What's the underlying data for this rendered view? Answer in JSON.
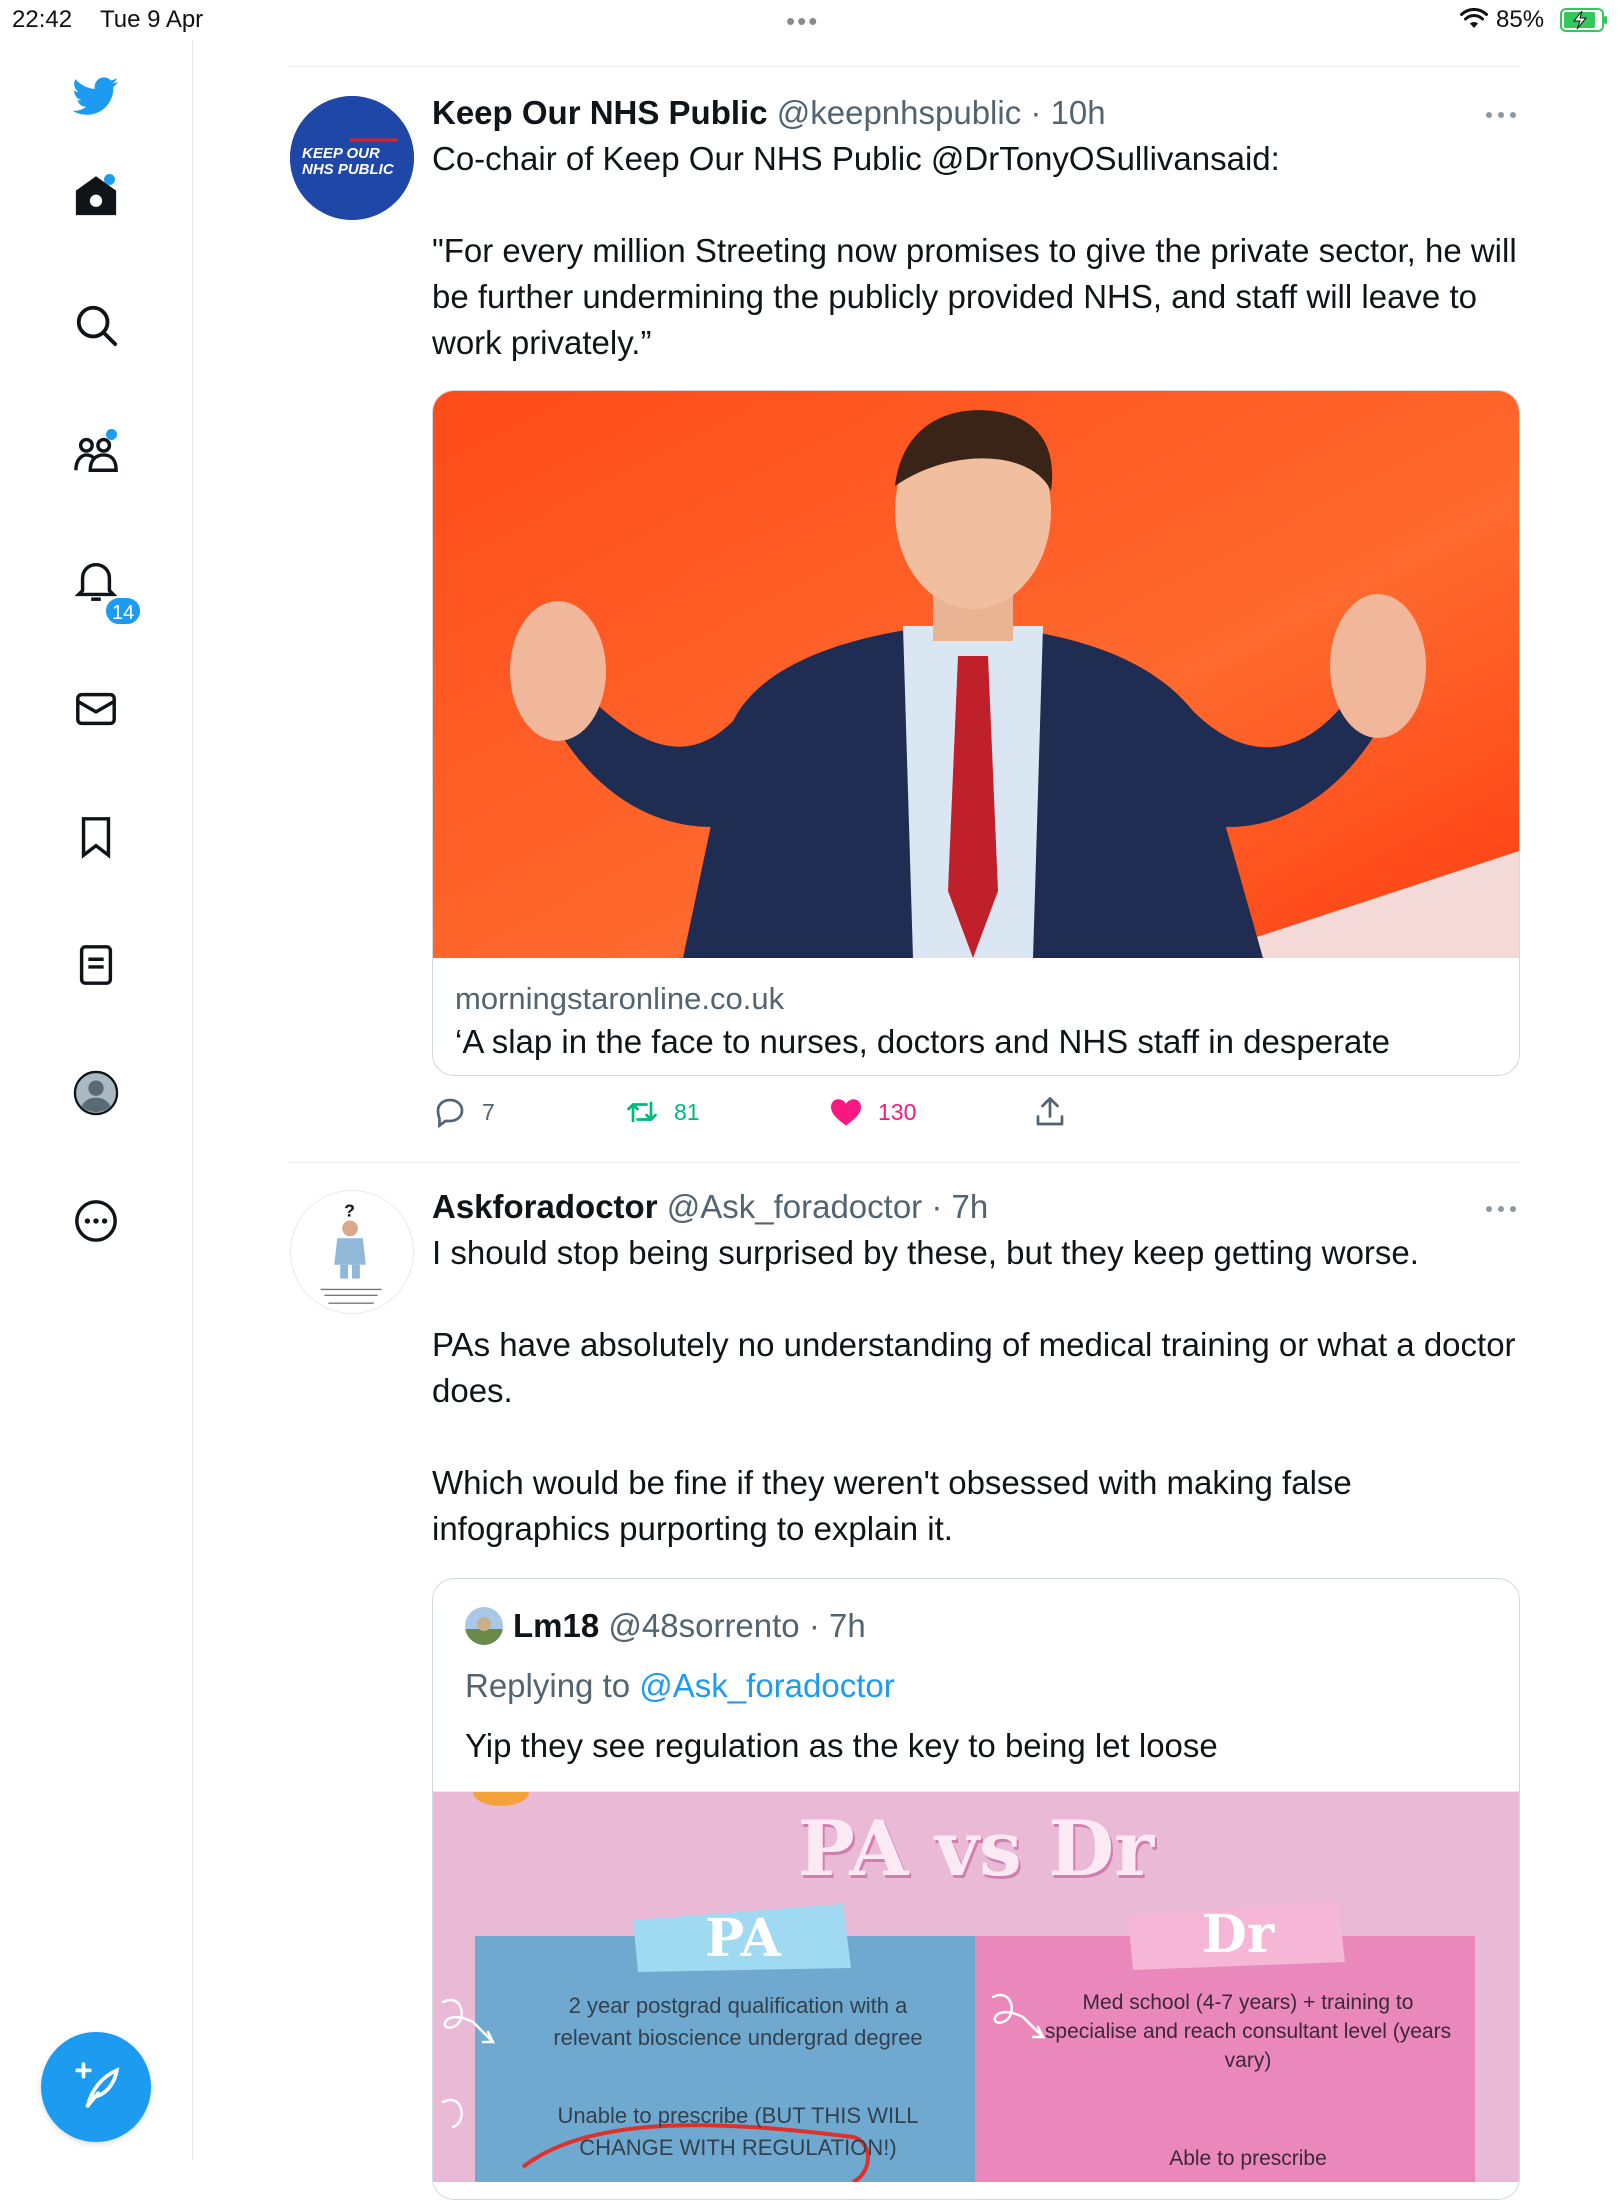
{
  "status_bar": {
    "time": "22:42",
    "date": "Tue 9 Apr",
    "battery": "85%"
  },
  "sidebar": {
    "items": [
      {
        "name": "twitter-logo",
        "icon": "bird-icon"
      },
      {
        "name": "home",
        "icon": "home-icon"
      },
      {
        "name": "explore",
        "icon": "search-icon"
      },
      {
        "name": "communities",
        "icon": "people-icon"
      },
      {
        "name": "notifications",
        "icon": "bell-icon",
        "badge": "14"
      },
      {
        "name": "messages",
        "icon": "mail-icon"
      },
      {
        "name": "bookmarks",
        "icon": "bookmark-icon"
      },
      {
        "name": "lists",
        "icon": "list-icon"
      },
      {
        "name": "profile",
        "icon": "avatar-icon"
      },
      {
        "name": "more",
        "icon": "more-circle-icon"
      }
    ],
    "notifications_badge": "14",
    "compose_icon": "compose-icon"
  },
  "colors": {
    "accent": "#1d9bf0",
    "retweet": "#00ba7c",
    "like": "#f91880",
    "muted": "#536471"
  },
  "tweets": [
    {
      "avatar_text": "KEEP OUR NHS PUBLIC",
      "name": "Keep Our NHS Public",
      "handle": "@keepnhspublic",
      "time": "10h",
      "text": "Co-chair of Keep Our NHS Public @DrTonyOSullivansaid:\n\n\"For every million Streeting now promises to give the private sector, he will be further undermining the publicly provided NHS, and staff will leave to work privately.”",
      "card": {
        "domain": "morningstaronline.co.uk",
        "title": "‘A slap in the face to nurses, doctors and NHS staff in desperate"
      },
      "actions": {
        "replies": "7",
        "retweets": "81",
        "likes": "130"
      }
    },
    {
      "name": "Askforadoctor",
      "handle": "@Ask_foradoctor",
      "time": "7h",
      "text": "I should stop being surprised by these, but they keep getting worse.\n\nPAs have absolutely no understanding of medical training or what a doctor does.\n\nWhich would be fine if they weren't obsessed with making false infographics purporting to explain it.",
      "quote": {
        "name": "Lm18",
        "handle": "@48sorrento",
        "time": "7h",
        "replying_label": "Replying to",
        "replying_to": "@Ask_foradoctor",
        "text": "Yip they see regulation as the key to being let loose",
        "infographic": {
          "title": "PA vs Dr",
          "left_header": "PA",
          "right_header": "Dr",
          "left_item_1": "2 year postgrad qualification with a relevant bioscience undergrad degree",
          "left_item_2": "Unable to prescribe (BUT THIS WILL CHANGE WITH REGULATION!)",
          "right_item_1": "Med school (4-7 years) + training to specialise  and reach consultant level (years vary)",
          "right_item_2": "Able to prescribe"
        }
      }
    }
  ]
}
